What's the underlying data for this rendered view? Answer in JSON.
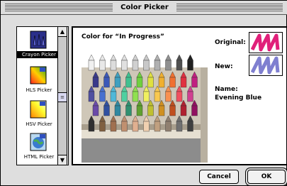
{
  "window": {
    "title": "Color Picker"
  },
  "sidebar": {
    "items": [
      {
        "label": "Crayon Picker",
        "icon": "crayon-icon",
        "selected": true
      },
      {
        "label": "HLS Picker",
        "icon": "hls-icon",
        "selected": false
      },
      {
        "label": "HSV Picker",
        "icon": "hsv-icon",
        "selected": false
      },
      {
        "label": "HTML Picker",
        "icon": "html-icon",
        "selected": false
      }
    ]
  },
  "panel": {
    "heading": "Color for “In Progress”",
    "original_label": "Original:",
    "new_label": "New:",
    "name_label": "Name:",
    "name_value": "Evening Blue",
    "original_color": "#e0207a",
    "new_color": "#7f7fd0"
  },
  "buttons": {
    "cancel": "Cancel",
    "ok": "OK"
  }
}
